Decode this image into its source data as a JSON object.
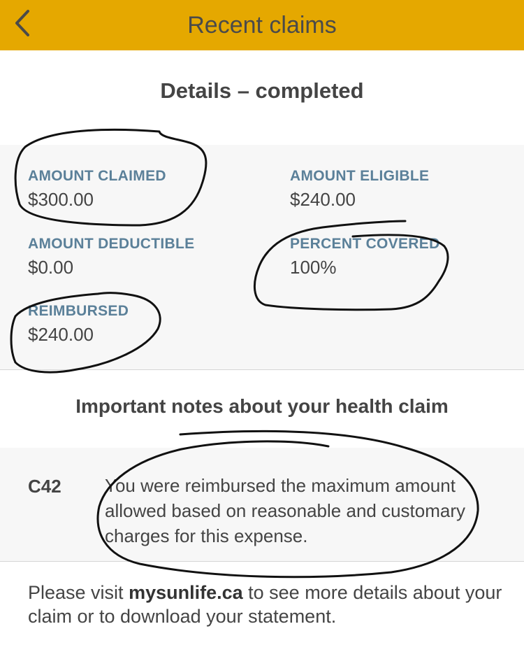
{
  "header": {
    "title": "Recent claims",
    "back_icon": "chevron-left-icon",
    "background": "#e5a800"
  },
  "details": {
    "title": "Details – completed",
    "fields": [
      {
        "label": "AMOUNT CLAIMED",
        "value": "$300.00"
      },
      {
        "label": "AMOUNT ELIGIBLE",
        "value": "$240.00"
      },
      {
        "label": "AMOUNT DEDUCTIBLE",
        "value": "$0.00"
      },
      {
        "label": "PERCENT COVERED",
        "value": "100%"
      },
      {
        "label": "REIMBURSED",
        "value": "$240.00"
      }
    ]
  },
  "notes": {
    "title": "Important notes about your health claim",
    "items": [
      {
        "code": "C42",
        "text": "You were reimbursed the maximum amount allowed based on reasonable and customary charges for this expense."
      }
    ]
  },
  "footer": {
    "prefix": "Please visit ",
    "link": "mysunlife.ca",
    "suffix": " to see more details about your claim or to download your statement."
  },
  "colors": {
    "label": "#5b8099",
    "panel": "#f7f7f7",
    "text": "#444444"
  }
}
